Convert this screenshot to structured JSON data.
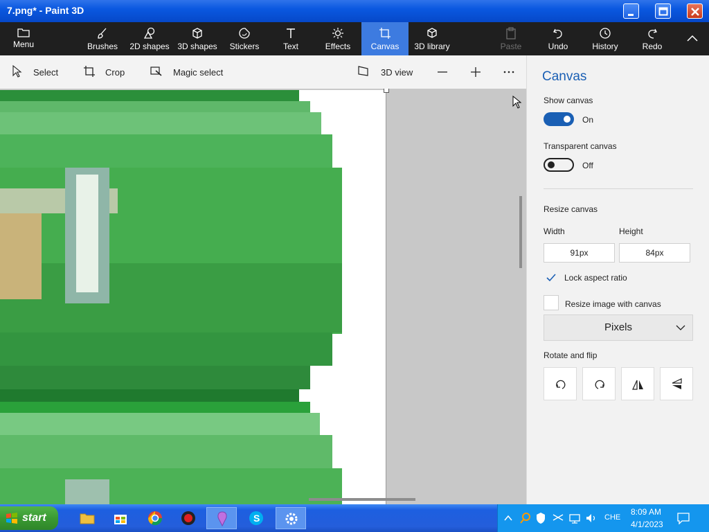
{
  "window": {
    "title": "7.png* - Paint 3D"
  },
  "commandbar": {
    "menu": "Menu",
    "brushes": "Brushes",
    "shapes2d": "2D shapes",
    "shapes3d": "3D shapes",
    "stickers": "Stickers",
    "text": "Text",
    "effects": "Effects",
    "canvas": "Canvas",
    "library3d": "3D library",
    "paste": "Paste",
    "undo": "Undo",
    "history": "History",
    "redo": "Redo"
  },
  "toolbar": {
    "select": "Select",
    "crop": "Crop",
    "magic_select": "Magic select",
    "view3d": "3D view"
  },
  "pane": {
    "heading": "Canvas",
    "show_canvas": {
      "label": "Show canvas",
      "state": "On"
    },
    "transparent_canvas": {
      "label": "Transparent canvas",
      "state": "Off"
    },
    "resize_canvas": "Resize canvas",
    "width_label": "Width",
    "height_label": "Height",
    "width_value": "91px",
    "height_value": "84px",
    "lock_aspect": "Lock aspect ratio",
    "resize_image": "Resize image with canvas",
    "units": "Pixels",
    "rotate_flip": "Rotate and flip"
  },
  "taskbar": {
    "start": "start",
    "language": "CHE",
    "time": "8:09 AM",
    "date": "4/1/2023"
  },
  "colors": {
    "accent": "#3d7be0",
    "toggle_on": "#1a5fb4",
    "cmdbar_bg": "#1f1f1f",
    "taskbar": "#245edb"
  }
}
